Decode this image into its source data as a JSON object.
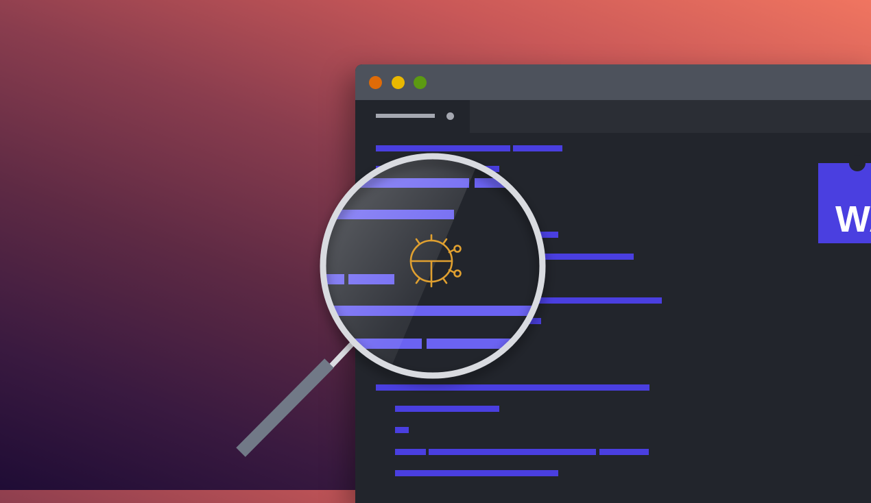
{
  "colors": {
    "code_accent": "#4a3fe0",
    "lens_code_accent": "#6b63f2",
    "editor_background": "#22252c",
    "titlebar": "#4d525c",
    "traffic_red": "#df6b08",
    "traffic_yellow": "#e9b800",
    "traffic_green": "#5c9a12",
    "bug_icon": "#e0a030",
    "lens_rim": "#d9dbe0",
    "handle": "#717987"
  },
  "badge": {
    "text": "WA"
  },
  "icons": {
    "lens": "magnifying-glass-icon",
    "bug": "bug-icon"
  }
}
